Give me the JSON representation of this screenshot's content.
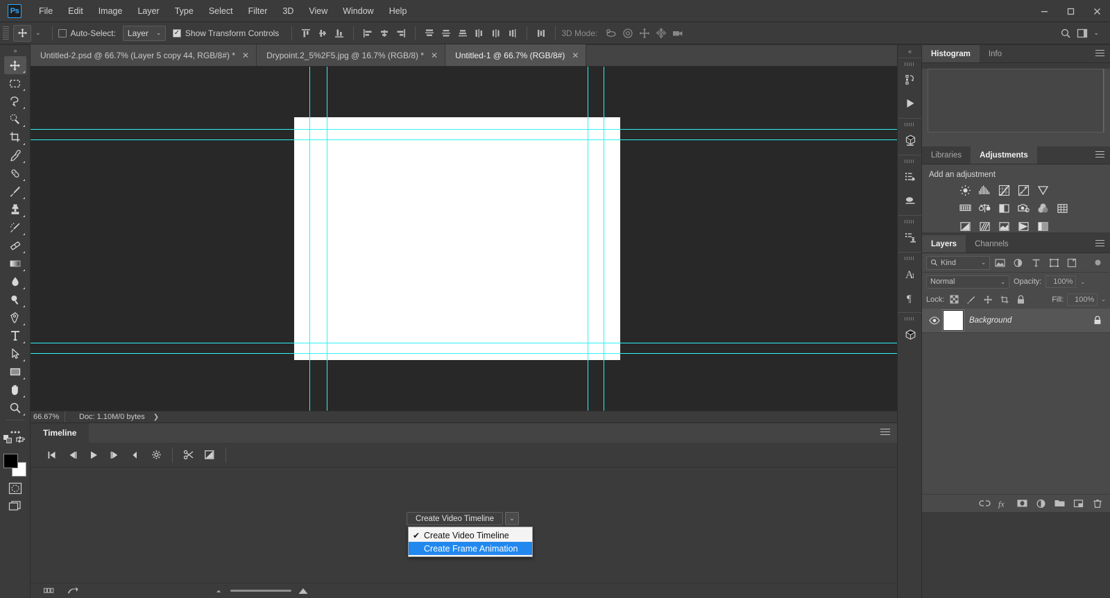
{
  "app": {
    "name": "Ps",
    "logo_color": "#31a8ff"
  },
  "titlebar": {
    "menus": [
      "File",
      "Edit",
      "Image",
      "Layer",
      "Type",
      "Select",
      "Filter",
      "3D",
      "View",
      "Window",
      "Help"
    ],
    "window_controls": {
      "minimize": "—",
      "maximize": "❐",
      "close": "✕"
    }
  },
  "options_bar": {
    "tool": "move-tool",
    "auto_select_label": "Auto-Select:",
    "auto_select_checked": false,
    "layer_select_value": "Layer",
    "show_transform_label": "Show Transform Controls",
    "show_transform_checked": true,
    "three_d_mode_label": "3D Mode:"
  },
  "toolbar": {
    "tools": [
      {
        "name": "move-tool",
        "selected": true
      },
      {
        "name": "rectangular-marquee-tool",
        "selected": false
      },
      {
        "name": "lasso-tool",
        "selected": false
      },
      {
        "name": "quick-selection-tool",
        "selected": false
      },
      {
        "name": "crop-tool",
        "selected": false
      },
      {
        "name": "eyedropper-tool",
        "selected": false
      },
      {
        "name": "spot-healing-brush-tool",
        "selected": false
      },
      {
        "name": "brush-tool",
        "selected": false
      },
      {
        "name": "clone-stamp-tool",
        "selected": false
      },
      {
        "name": "history-brush-tool",
        "selected": false
      },
      {
        "name": "eraser-tool",
        "selected": false
      },
      {
        "name": "gradient-tool",
        "selected": false
      },
      {
        "name": "blur-tool",
        "selected": false
      },
      {
        "name": "dodge-tool",
        "selected": false
      },
      {
        "name": "pen-tool",
        "selected": false
      },
      {
        "name": "horizontal-type-tool",
        "selected": false
      },
      {
        "name": "path-selection-tool",
        "selected": false
      },
      {
        "name": "rectangle-tool",
        "selected": false
      },
      {
        "name": "hand-tool",
        "selected": false
      },
      {
        "name": "zoom-tool",
        "selected": false
      },
      {
        "name": "edit-toolbar-tool",
        "selected": false
      }
    ],
    "foreground_color": "#000000",
    "background_color": "#ffffff"
  },
  "document_tabs": [
    {
      "label": "Untitled-2.psd @ 66.7% (Layer 5 copy 44, RGB/8#) *",
      "active": false,
      "close": "✕"
    },
    {
      "label": "Drypoint.2_5%2F5.jpg @ 16.7% (RGB/8) *",
      "active": false,
      "close": "✕"
    },
    {
      "label": "Untitled-1 @ 66.7% (RGB/8#)",
      "active": true,
      "close": "✕"
    }
  ],
  "canvas": {
    "guide_color": "#2ff2f2",
    "artboard_color": "#ffffff",
    "background_color": "#282828",
    "vertical_guides": [
      402,
      427,
      803,
      826
    ],
    "horizontal_guides": [
      90,
      105,
      398,
      413
    ]
  },
  "status_bar": {
    "zoom": "66.67%",
    "doc_info": "Doc: 1.10M/0 bytes",
    "expand_arrow": "❯"
  },
  "timeline": {
    "tab_label": "Timeline",
    "controls": [
      "go-to-first-frame-icon",
      "previous-frame-icon",
      "play-icon",
      "next-frame-icon",
      "audio-icon",
      "settings-gear-icon",
      "split-at-playhead-icon",
      "transition-icon"
    ],
    "footer": {
      "onion_skin_icon": "onion-skin-icon",
      "convert_icon": "convert-to-frame-animation-icon",
      "zoom_out_icon": "zoom-out-icon",
      "zoom_in_icon": "zoom-in-icon"
    }
  },
  "timeline_dropdown": {
    "button_label": "Create Video Timeline",
    "arrow": "⌄",
    "items": [
      {
        "label": "Create Video Timeline",
        "checked": true,
        "highlighted": false
      },
      {
        "label": "Create Frame Animation",
        "checked": false,
        "highlighted": true
      }
    ]
  },
  "rail": {
    "collapse_icon": "collapse-panels-icon",
    "groups": [
      [
        "history-icon",
        "play-actions-icon"
      ],
      [
        "3d-icon"
      ],
      [
        "properties-icon",
        "brush-presets-icon"
      ],
      [
        "clone-source-icon"
      ],
      [
        "character-icon",
        "paragraph-icon"
      ],
      [
        "3d-materials-icon"
      ]
    ]
  },
  "panels": {
    "histogram": {
      "tabs": [
        {
          "label": "Histogram",
          "active": true
        },
        {
          "label": "Info",
          "active": false
        }
      ]
    },
    "adjustments": {
      "tabs": [
        {
          "label": "Libraries",
          "active": false
        },
        {
          "label": "Adjustments",
          "active": true
        }
      ],
      "title": "Add an adjustment",
      "icons": [
        [
          "brightness-contrast-icon",
          "levels-icon",
          "curves-icon",
          "exposure-icon",
          "vibrance-icon"
        ],
        [
          "hue-saturation-icon",
          "color-balance-icon",
          "black-white-icon",
          "photo-filter-icon",
          "channel-mixer-icon",
          "color-lookup-icon"
        ],
        [
          "invert-icon",
          "posterize-icon",
          "threshold-icon",
          "gradient-map-icon",
          "selective-color-icon"
        ]
      ]
    },
    "layers": {
      "tabs": [
        {
          "label": "Layers",
          "active": true
        },
        {
          "label": "Channels",
          "active": false
        }
      ],
      "filter": {
        "kind_label": "Kind",
        "search_icon": "search-icon",
        "filter_icons": [
          "filter-pixel-icon",
          "filter-adjustment-icon",
          "filter-type-icon",
          "filter-shape-icon",
          "filter-smartobject-icon",
          "filter-toggle-icon"
        ]
      },
      "blend_mode": "Normal",
      "opacity_label": "Opacity:",
      "opacity_value": "100%",
      "lock_label": "Lock:",
      "lock_icons": [
        "lock-transparent-pixels-icon",
        "lock-image-pixels-icon",
        "lock-position-icon",
        "lock-artboard-icon",
        "lock-all-icon"
      ],
      "fill_label": "Fill:",
      "fill_value": "100%",
      "rows": [
        {
          "name": "Background",
          "visible": true,
          "locked": true,
          "thumb_color": "#ffffff"
        }
      ],
      "footer_icons": [
        "link-layers-icon",
        "layer-style-fx-icon",
        "add-layer-mask-icon",
        "new-adjustment-layer-icon",
        "new-group-icon",
        "new-layer-icon",
        "delete-layer-icon"
      ]
    }
  }
}
